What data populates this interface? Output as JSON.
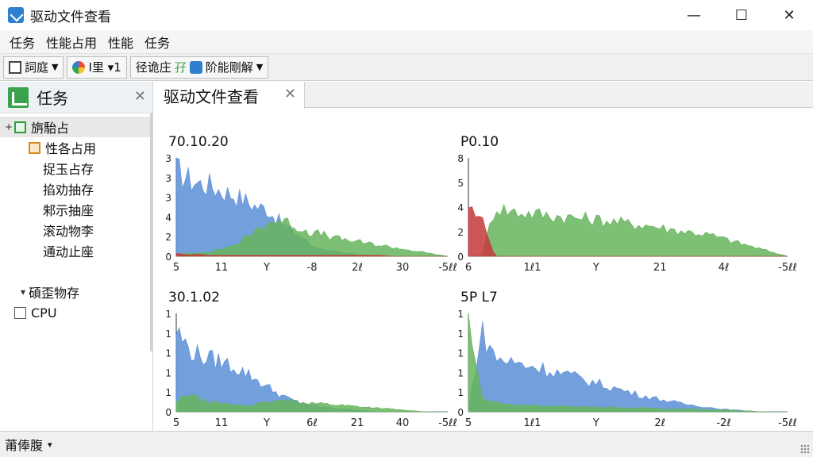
{
  "window": {
    "title": "驱动文件查看",
    "controls": {
      "minimize": "—",
      "maximize": "☐",
      "close": "✕"
    }
  },
  "menu": [
    "任务",
    "性能占用",
    "性能",
    "任务"
  ],
  "toolbar": [
    {
      "label": "詞庭",
      "icon": "list-icon",
      "color": "#444444"
    },
    {
      "label": "I里 ▾1",
      "icon": "color-wheel-icon",
      "color": "#e84b3a"
    },
    {
      "label": "径诡庄",
      "icon": "",
      "color": ""
    },
    {
      "label": "孖",
      "icon": "",
      "color": "#3aa24a"
    },
    {
      "label": "阶能剛解",
      "icon": "drive-icon",
      "color": "#2f7fd0"
    }
  ],
  "left_panel": {
    "title": "任务",
    "close": "✕",
    "tree": [
      {
        "label": "旃駘占",
        "expander": "+",
        "icon": "green-box-icon",
        "indent": 0,
        "selected": true
      },
      {
        "label": "性各占用",
        "expander": "",
        "icon": "orange-box-icon",
        "indent": 1,
        "selected": false
      },
      {
        "label": "捉玉占存",
        "expander": "",
        "icon": "",
        "indent": 2,
        "selected": false
      },
      {
        "label": "掐劝抽存",
        "expander": "",
        "icon": "",
        "indent": 2,
        "selected": false
      },
      {
        "label": "邾示抽座",
        "expander": "",
        "icon": "",
        "indent": 2,
        "selected": false
      },
      {
        "label": "滚动物李",
        "expander": "",
        "icon": "",
        "indent": 2,
        "selected": false
      },
      {
        "label": "通动止座",
        "expander": "",
        "icon": "",
        "indent": 2,
        "selected": false
      },
      {
        "label": "",
        "expander": "",
        "icon": "",
        "indent": 0,
        "selected": false
      },
      {
        "label": "碩歪物存",
        "expander": "▾",
        "icon": "",
        "indent": 1,
        "selected": false
      },
      {
        "label": "CPU",
        "expander": "",
        "icon": "cpu-icon",
        "indent": 0,
        "selected": false
      }
    ]
  },
  "tab": {
    "label": "驱动文件查看",
    "close": "✕"
  },
  "status": {
    "text": "莆俸腹",
    "caret": "▾"
  },
  "chart_data": [
    {
      "type": "area",
      "title": "70.10.20",
      "y_ticks": [
        "0",
        "2",
        "4",
        "3",
        "3",
        "3"
      ],
      "x_ticks": [
        "5",
        "11",
        "Y",
        "-8",
        "2ℓ",
        "30",
        "-5ℓℓ"
      ],
      "ylim": [
        0,
        3
      ],
      "series": [
        {
          "color": "#5b8fd6",
          "shape": [
            0.95,
            0.85,
            0.8,
            0.78,
            0.72,
            0.68,
            0.62,
            0.55,
            0.52,
            0.4,
            0.3,
            0.22,
            0.12,
            0.08,
            0.05,
            0.03,
            0.02,
            0.01,
            0.0,
            0.0,
            0.0,
            0.0,
            0.0,
            0.0,
            0.0
          ]
        },
        {
          "color": "#66b45c",
          "shape": [
            0.02,
            0.03,
            0.04,
            0.05,
            0.08,
            0.12,
            0.18,
            0.28,
            0.36,
            0.4,
            0.36,
            0.3,
            0.26,
            0.24,
            0.2,
            0.18,
            0.16,
            0.14,
            0.12,
            0.1,
            0.08,
            0.06,
            0.04,
            0.02,
            0.0
          ]
        },
        {
          "color": "#c43a3a",
          "shape": [
            0.03,
            0.02,
            0.02,
            0.01,
            0.01,
            0.01,
            0.01,
            0.01,
            0.01,
            0.01,
            0.01,
            0.01,
            0.01,
            0.01,
            0.01,
            0.01,
            0.01,
            0.01,
            0.01,
            0.0,
            0.0,
            0.0,
            0.0,
            0.0,
            0.0
          ]
        }
      ]
    },
    {
      "type": "area",
      "title": "P0.10",
      "y_ticks": [
        "0",
        "2",
        "4",
        "5",
        "8"
      ],
      "x_ticks": [
        "6",
        "1ℓ1",
        "Y",
        "21",
        "4ℓ",
        "-5ℓℓ"
      ],
      "ylim": [
        0,
        8
      ],
      "series": [
        {
          "color": "#66b45c",
          "shape": [
            0.0,
            0.0,
            0.55,
            0.5,
            0.48,
            0.47,
            0.45,
            0.44,
            0.42,
            0.41,
            0.4,
            0.38,
            0.36,
            0.35,
            0.33,
            0.3,
            0.28,
            0.26,
            0.24,
            0.2,
            0.16,
            0.12,
            0.08,
            0.04,
            0.0
          ]
        },
        {
          "color": "#c43a3a",
          "shape": [
            0.55,
            0.4,
            0.0,
            0.0,
            0.0,
            0.0,
            0.0,
            0.0,
            0.0,
            0.0,
            0.0,
            0.0,
            0.0,
            0.0,
            0.0,
            0.0,
            0.0,
            0.0,
            0.0,
            0.0,
            0.0,
            0.0,
            0.0,
            0.0,
            0.0
          ]
        }
      ]
    },
    {
      "type": "area",
      "title": "30.1.02",
      "y_ticks": [
        "0",
        "1",
        "1",
        "1",
        "1",
        "1"
      ],
      "x_ticks": [
        "5",
        "11",
        "Y",
        "6ℓ",
        "21",
        "40",
        "-5ℓℓ"
      ],
      "ylim": [
        0,
        1
      ],
      "series": [
        {
          "color": "#5b8fd6",
          "shape": [
            0.9,
            0.7,
            0.62,
            0.58,
            0.55,
            0.5,
            0.44,
            0.36,
            0.28,
            0.2,
            0.14,
            0.1,
            0.07,
            0.05,
            0.04,
            0.03,
            0.02,
            0.01,
            0.0,
            0.0,
            0.0,
            0.0,
            0.0,
            0.0,
            0.0
          ]
        },
        {
          "color": "#66b45c",
          "shape": [
            0.1,
            0.2,
            0.14,
            0.1,
            0.09,
            0.08,
            0.07,
            0.08,
            0.1,
            0.12,
            0.12,
            0.11,
            0.1,
            0.09,
            0.08,
            0.07,
            0.06,
            0.05,
            0.04,
            0.03,
            0.02,
            0.01,
            0.0,
            0.0,
            0.0
          ]
        }
      ]
    },
    {
      "type": "area",
      "title": "5P L7",
      "y_ticks": [
        "0",
        "1",
        "1",
        "1",
        "1",
        "1"
      ],
      "x_ticks": [
        "5",
        "1ℓ1",
        "Y",
        "2ℓ",
        "-2ℓ",
        "-5ℓℓ"
      ],
      "ylim": [
        0,
        1
      ],
      "series": [
        {
          "color": "#5b8fd6",
          "shape": [
            0.05,
            0.88,
            0.6,
            0.55,
            0.52,
            0.5,
            0.46,
            0.42,
            0.38,
            0.34,
            0.3,
            0.26,
            0.22,
            0.18,
            0.15,
            0.12,
            0.09,
            0.07,
            0.05,
            0.03,
            0.02,
            0.01,
            0.0,
            0.0,
            0.0
          ]
        },
        {
          "color": "#66b45c",
          "shape": [
            0.95,
            0.15,
            0.1,
            0.08,
            0.07,
            0.07,
            0.06,
            0.06,
            0.06,
            0.05,
            0.05,
            0.05,
            0.04,
            0.04,
            0.04,
            0.03,
            0.03,
            0.03,
            0.02,
            0.02,
            0.01,
            0.01,
            0.0,
            0.0,
            0.0
          ]
        }
      ]
    }
  ]
}
